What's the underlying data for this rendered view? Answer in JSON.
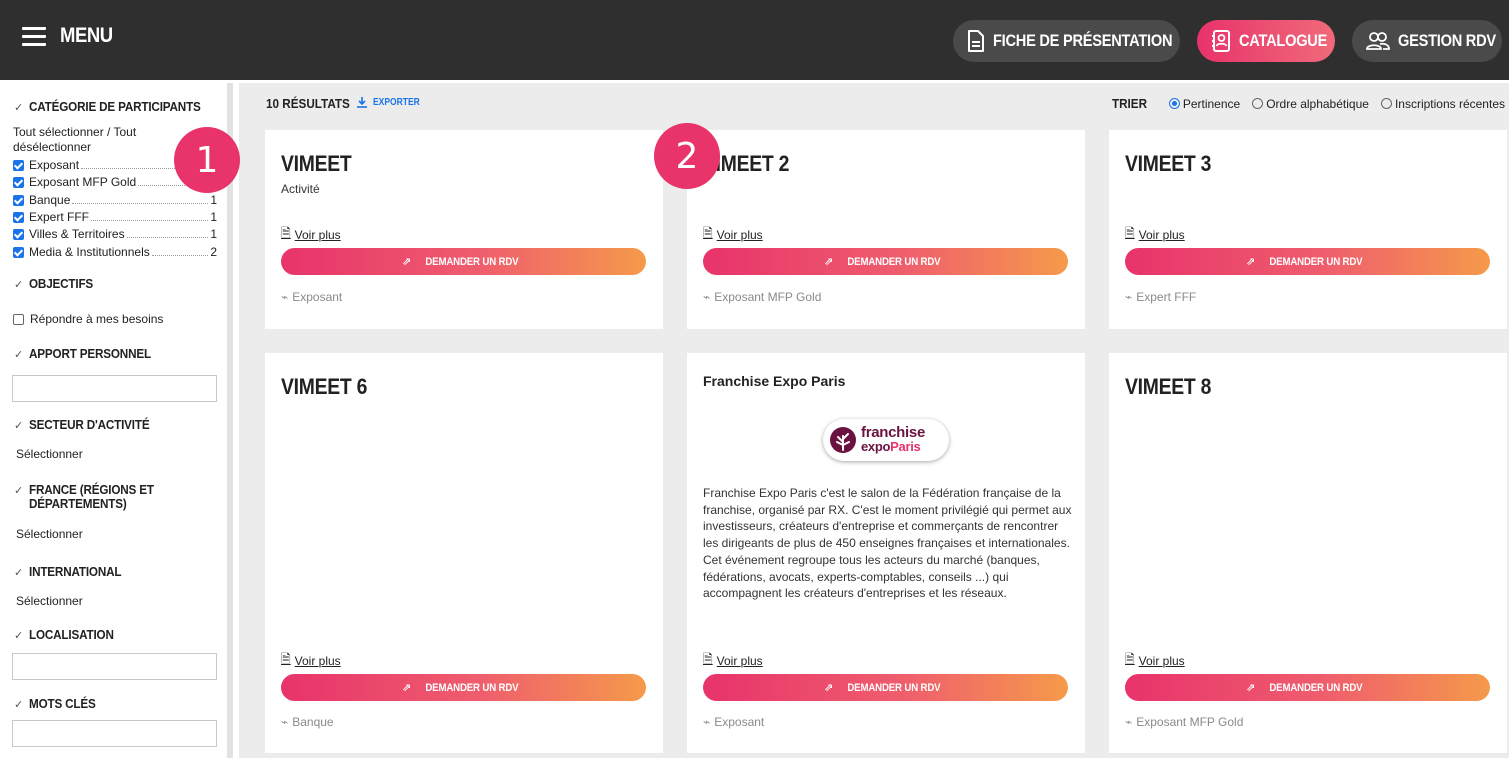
{
  "header": {
    "menu_label": "MENU",
    "fiche_label": "FICHE DE PRÉSENTATION",
    "catalogue_label": "CATALOGUE",
    "gestion_label": "GESTION RDV"
  },
  "sidebar": {
    "categorie": {
      "title": "CATÉGORIE DE PARTICIPANTS",
      "select_all": "Tout sélectionner / Tout désélectionner",
      "items": [
        {
          "label": "Exposant",
          "count": ""
        },
        {
          "label": "Exposant MFP Gold",
          "count": ""
        },
        {
          "label": "Banque",
          "count": "1"
        },
        {
          "label": "Expert FFF",
          "count": "1"
        },
        {
          "label": "Villes & Territoires",
          "count": "1"
        },
        {
          "label": "Media & Institutionnels",
          "count": "2"
        }
      ]
    },
    "objectifs": {
      "title": "OBJECTIFS",
      "option": "Répondre à mes besoins"
    },
    "apport": {
      "title": "APPORT PERSONNEL",
      "value": ""
    },
    "secteur": {
      "title": "SECTEUR D'ACTIVITÉ",
      "select": "Sélectionner"
    },
    "france": {
      "title": "FRANCE (RÉGIONS ET DÉPARTEMENTS)",
      "select": "Sélectionner"
    },
    "international": {
      "title": "INTERNATIONAL",
      "select": "Sélectionner"
    },
    "localisation": {
      "title": "LOCALISATION",
      "value": ""
    },
    "mots_cles": {
      "title": "MOTS CLÉS",
      "value": ""
    }
  },
  "main": {
    "results": "10 RÉSULTATS",
    "export": "EXPORTER",
    "sort": {
      "label": "TRIER",
      "options": [
        "Pertinence",
        "Ordre alphabétique",
        "Inscriptions récentes"
      ],
      "selected": "Pertinence"
    },
    "voir_plus": "Voir plus",
    "rdv_label": "DEMANDER UN RDV",
    "cards": [
      {
        "title": "VIMEET",
        "subtitle": "Activité",
        "tag": "Exposant"
      },
      {
        "title": "VIMEET 2",
        "tag": "Exposant MFP Gold"
      },
      {
        "title": "VIMEET 3",
        "tag": "Expert FFF"
      },
      {
        "title": "VIMEET 6",
        "tag": "Banque"
      },
      {
        "title": "Franchise Expo Paris",
        "tag": "Exposant",
        "logo_line1": "franchise",
        "logo_line2a": "expo",
        "logo_line2b": "Paris",
        "description": "Franchise Expo Paris c'est le salon de la Fédération française de la franchise, organisé par RX. C'est le moment privilégié qui permet aux investisseurs, créateurs d'entreprise et commerçants de rencontrer les dirigeants de plus de 450 enseignes françaises et internationales. Cet événement regroupe tous les acteurs du marché (banques, fédérations, avocats, experts-comptables, conseils ...) qui accompagnent les créateurs d'entreprises et les réseaux."
      },
      {
        "title": "VIMEET 8",
        "tag": "Exposant MFP Gold"
      }
    ]
  },
  "callouts": [
    "1",
    "2"
  ],
  "colors": {
    "accent": "#e8336b",
    "accent_end": "#f59a4a",
    "topbar": "#2f2f2f",
    "link": "#1a73e8"
  }
}
